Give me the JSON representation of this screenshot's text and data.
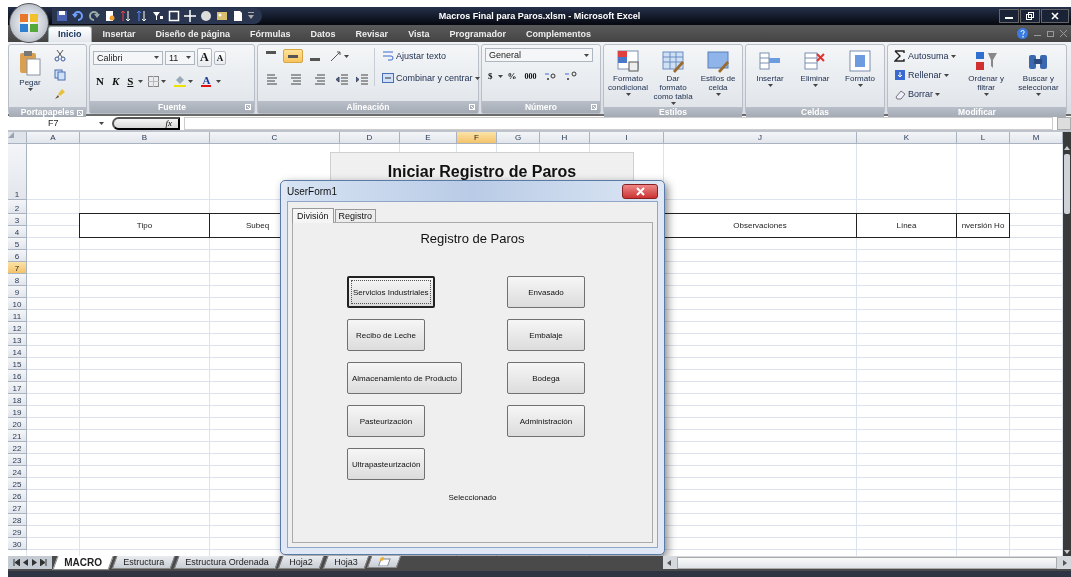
{
  "window": {
    "title": "Macros Final para Paros.xlsm - Microsoft Excel"
  },
  "ribbon_tabs": [
    {
      "label": "Inicio",
      "selected": true
    },
    {
      "label": "Insertar",
      "selected": false
    },
    {
      "label": "Diseño de página",
      "selected": false
    },
    {
      "label": "Fórmulas",
      "selected": false
    },
    {
      "label": "Datos",
      "selected": false
    },
    {
      "label": "Revisar",
      "selected": false
    },
    {
      "label": "Vista",
      "selected": false
    },
    {
      "label": "Programador",
      "selected": false
    },
    {
      "label": "Complementos",
      "selected": false
    }
  ],
  "ribbon": {
    "clipboard": {
      "label": "Portapapeles",
      "paste": "Pegar"
    },
    "font": {
      "label": "Fuente",
      "font_name": "Calibri",
      "font_size": "11",
      "grow": "A",
      "shrink": "A",
      "bold": "N",
      "italic": "K",
      "underline": "S",
      "font_color": "A"
    },
    "alignment": {
      "label": "Alineación",
      "vertical_align": [
        {
          "selected": false
        },
        {
          "selected": true
        },
        {
          "selected": false
        }
      ],
      "wrap_text": "Ajustar texto",
      "merge": "Combinar y centrar"
    },
    "number": {
      "label": "Número",
      "format": "General",
      "currency": "$",
      "percent": "%",
      "thousands": "000"
    },
    "styles": {
      "label": "Estilos",
      "buttons": [
        "Formato condicional",
        "Dar formato como tabla",
        "Estilos de celda"
      ]
    },
    "cells": {
      "label": "Celdas",
      "buttons": [
        "Insertar",
        "Eliminar",
        "Formato"
      ]
    },
    "editing": {
      "label": "Modificar",
      "items": [
        "Autosuma",
        "Rellenar",
        "Borrar"
      ],
      "buttons": [
        "Ordenar y filtrar",
        "Buscar y seleccionar"
      ]
    }
  },
  "formula_bar": {
    "name_box": "F7",
    "fx": "fx"
  },
  "sheet": {
    "columns": [
      {
        "label": "A",
        "selected": false
      },
      {
        "label": "B",
        "selected": false
      },
      {
        "label": "C",
        "selected": false
      },
      {
        "label": "D",
        "selected": false
      },
      {
        "label": "E",
        "selected": false
      },
      {
        "label": "F",
        "selected": true
      },
      {
        "label": "G",
        "selected": false
      },
      {
        "label": "H",
        "selected": false
      },
      {
        "label": "I",
        "selected": false
      },
      {
        "label": "J",
        "selected": false
      },
      {
        "label": "K",
        "selected": false
      },
      {
        "label": "L",
        "selected": false
      },
      {
        "label": "M",
        "selected": false
      }
    ],
    "rows": [
      {
        "label": "1",
        "selected": false
      },
      {
        "label": "2",
        "selected": false
      },
      {
        "label": "3",
        "selected": false
      },
      {
        "label": "4",
        "selected": false
      },
      {
        "label": "5",
        "selected": false
      },
      {
        "label": "6",
        "selected": false
      },
      {
        "label": "7",
        "selected": true
      },
      {
        "label": "8",
        "selected": false
      },
      {
        "label": "9",
        "selected": false
      },
      {
        "label": "10",
        "selected": false
      },
      {
        "label": "11",
        "selected": false
      },
      {
        "label": "12",
        "selected": false
      },
      {
        "label": "13",
        "selected": false
      },
      {
        "label": "14",
        "selected": false
      },
      {
        "label": "15",
        "selected": false
      },
      {
        "label": "16",
        "selected": false
      },
      {
        "label": "17",
        "selected": false
      },
      {
        "label": "18",
        "selected": false
      },
      {
        "label": "19",
        "selected": false
      },
      {
        "label": "20",
        "selected": false
      },
      {
        "label": "21",
        "selected": false
      },
      {
        "label": "22",
        "selected": false
      },
      {
        "label": "23",
        "selected": false
      },
      {
        "label": "24",
        "selected": false
      },
      {
        "label": "25",
        "selected": false
      },
      {
        "label": "26",
        "selected": false
      },
      {
        "label": "27",
        "selected": false
      },
      {
        "label": "28",
        "selected": false
      },
      {
        "label": "29",
        "selected": false
      },
      {
        "label": "30",
        "selected": false
      }
    ],
    "table_header": [
      "Tipo",
      "Subeq",
      "Observaciones",
      "Línea",
      "nversión Ho"
    ]
  },
  "banner": {
    "text": "Iniciar Registro de Paros"
  },
  "userform": {
    "title": "UserForm1",
    "tabs": [
      {
        "label": "División",
        "selected": true
      },
      {
        "label": "Registro",
        "selected": false
      }
    ],
    "heading": "Registro de Paros",
    "left_buttons": [
      {
        "label": "Servicios Industriales",
        "focused": true
      },
      {
        "label": "Recibo de Leche",
        "focused": false
      },
      {
        "label": "Almacenamiento de Producto",
        "focused": false
      },
      {
        "label": "Pasteurización",
        "focused": false
      },
      {
        "label": "Ultrapasteurización",
        "focused": false
      }
    ],
    "right_buttons": [
      {
        "label": "Envasado",
        "focused": false
      },
      {
        "label": "Embalaje",
        "focused": false
      },
      {
        "label": "Bodega",
        "focused": false
      },
      {
        "label": "Administración",
        "focused": false
      }
    ],
    "status": "Seleccionado"
  },
  "sheet_tabs": [
    {
      "label": "MACRO",
      "selected": true
    },
    {
      "label": "Estructura",
      "selected": false
    },
    {
      "label": "Estructura Ordenada",
      "selected": false
    },
    {
      "label": "Hoja2",
      "selected": false
    },
    {
      "label": "Hoja3",
      "selected": false
    }
  ]
}
